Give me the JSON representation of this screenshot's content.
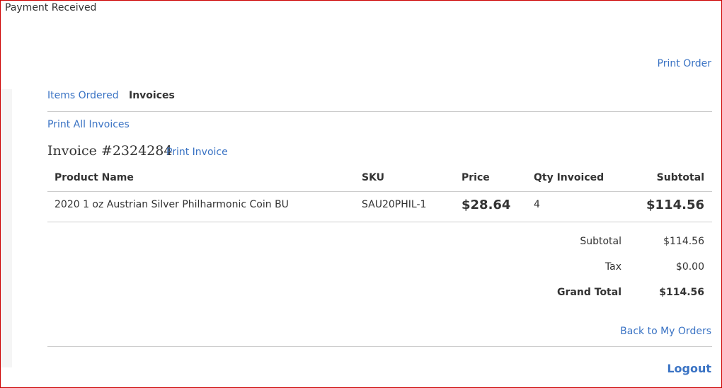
{
  "status_text": "Payment Received",
  "header": {
    "print_order": "Print Order"
  },
  "tabs": [
    {
      "label": "Items Ordered",
      "active": false
    },
    {
      "label": "Invoices",
      "active": true
    }
  ],
  "invoices": {
    "print_all": "Print All Invoices",
    "title": "Invoice #2324284",
    "print_invoice": "Print Invoice"
  },
  "table": {
    "headers": [
      "Product Name",
      "SKU",
      "Price",
      "Qty Invoiced",
      "Subtotal"
    ],
    "rows": [
      {
        "product": "2020 1 oz Austrian Silver Philharmonic Coin BU",
        "sku": "SAU20PHIL-1",
        "price": "$28.64",
        "qty": "4",
        "subtotal": "$114.56"
      }
    ]
  },
  "totals": [
    {
      "label": "Subtotal",
      "value": "$114.56"
    },
    {
      "label": "Tax",
      "value": "$0.00"
    },
    {
      "label": "Grand Total",
      "value": "$114.56"
    }
  ],
  "footer": {
    "back_link": "Back to My Orders",
    "logout": "Logout"
  },
  "colors": {
    "link": "#3a73c4",
    "border": "#cc0000",
    "divider": "#cccccc"
  }
}
